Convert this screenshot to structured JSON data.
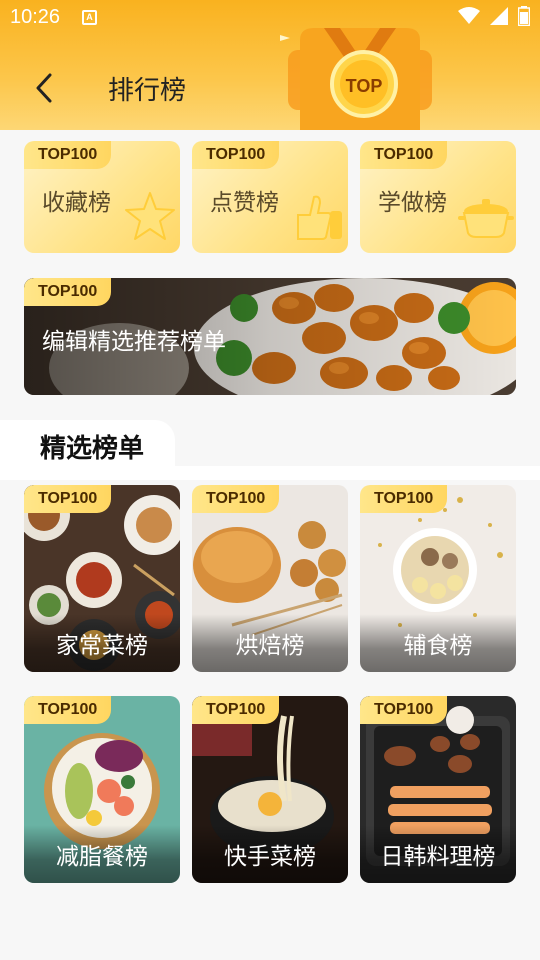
{
  "status_bar": {
    "time": "10:26",
    "notification": "A"
  },
  "header": {
    "title": "排行榜",
    "badge": "TOP"
  },
  "categories": [
    {
      "tag": "TOP100",
      "label": "收藏榜",
      "icon": "star-icon"
    },
    {
      "tag": "TOP100",
      "label": "点赞榜",
      "icon": "thumbs-up-icon"
    },
    {
      "tag": "TOP100",
      "label": "学做榜",
      "icon": "pot-icon"
    }
  ],
  "banner": {
    "tag": "TOP100",
    "label": "编辑精选推荐榜单"
  },
  "section": {
    "title": "精选榜单"
  },
  "lists": [
    {
      "tag": "TOP100",
      "label": "家常菜榜"
    },
    {
      "tag": "TOP100",
      "label": "烘焙榜"
    },
    {
      "tag": "TOP100",
      "label": "辅食榜"
    },
    {
      "tag": "TOP100",
      "label": "减脂餐榜"
    },
    {
      "tag": "TOP100",
      "label": "快手菜榜"
    },
    {
      "tag": "TOP100",
      "label": "日韩料理榜"
    }
  ],
  "colors": {
    "header": "#f9b21f",
    "tag": "#ffd660",
    "tag_text": "#4a2b00"
  }
}
